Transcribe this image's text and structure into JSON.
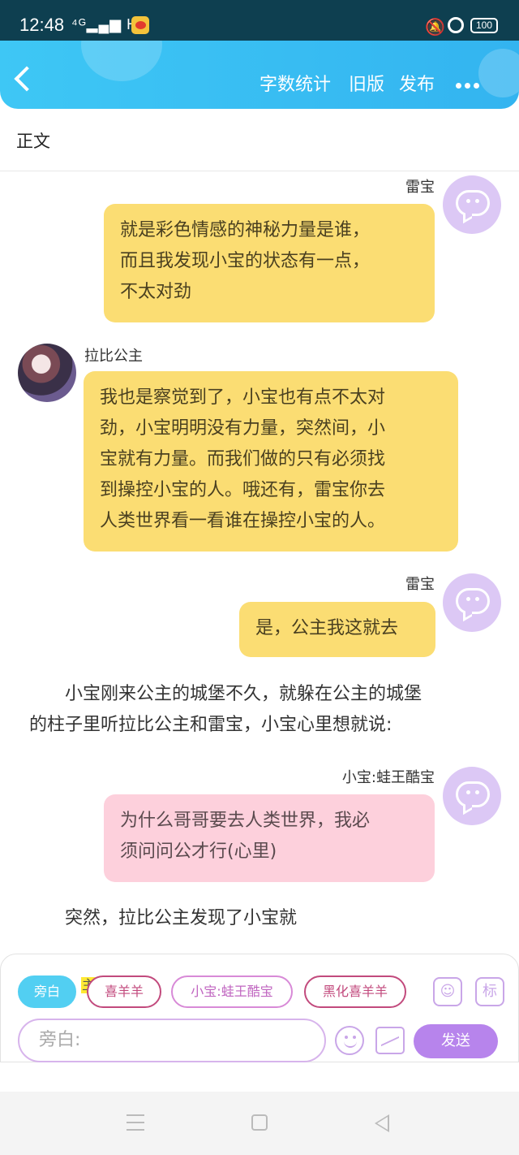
{
  "status_bar": {
    "time": "12:48",
    "network": "HD",
    "battery": "100"
  },
  "header": {
    "word_count": "字数统计",
    "old_version": "旧版",
    "publish": "发布"
  },
  "section_label": "正文",
  "messages": [
    {
      "speaker": "雷宝",
      "text_lines": [
        "就是彩色情感的神秘力量是谁，",
        "而且我发现小宝的状态有一点，",
        "不太对劲"
      ]
    },
    {
      "speaker": "拉比公主",
      "text_lines": [
        "我也是察觉到了，小宝也有点不太对",
        "劲，小宝明明没有力量，突然间，小",
        "宝就有力量。而我们做的只有必须找",
        "到操控小宝的人。哦还有，雷宝你去",
        "人类世界看一看谁在操控小宝的人。"
      ]
    },
    {
      "speaker": "雷宝",
      "text_lines": [
        "是，公主我这就去"
      ]
    },
    {
      "speaker": "小宝:蛙王酷宝",
      "text_lines": [
        "为什么哥哥要去人类世界，我必",
        "须问问公才行(心里)"
      ]
    }
  ],
  "narrations": [
    {
      "lines": [
        "小宝刚来公主的城堡不久，就躲在公主的城堡",
        "的柱子里听拉比公主和雷宝，小宝心里想就说:"
      ]
    },
    {
      "lines": [
        "突然，拉比公主发现了小宝就"
      ]
    }
  ],
  "composer": {
    "chips": [
      "旁白",
      "喜羊羊",
      "小宝:蛙王酷宝",
      "黑化喜羊羊"
    ],
    "highlight_mark": "主",
    "tag_icon": "标",
    "input_placeholder": "旁白:",
    "send": "发送"
  },
  "colors": {
    "header": "#38bdf2",
    "yellow_bubble": "#fbdd73",
    "pink_bubble": "#fdd0dc",
    "send": "#b784ec",
    "active_chip": "#52cff2"
  }
}
